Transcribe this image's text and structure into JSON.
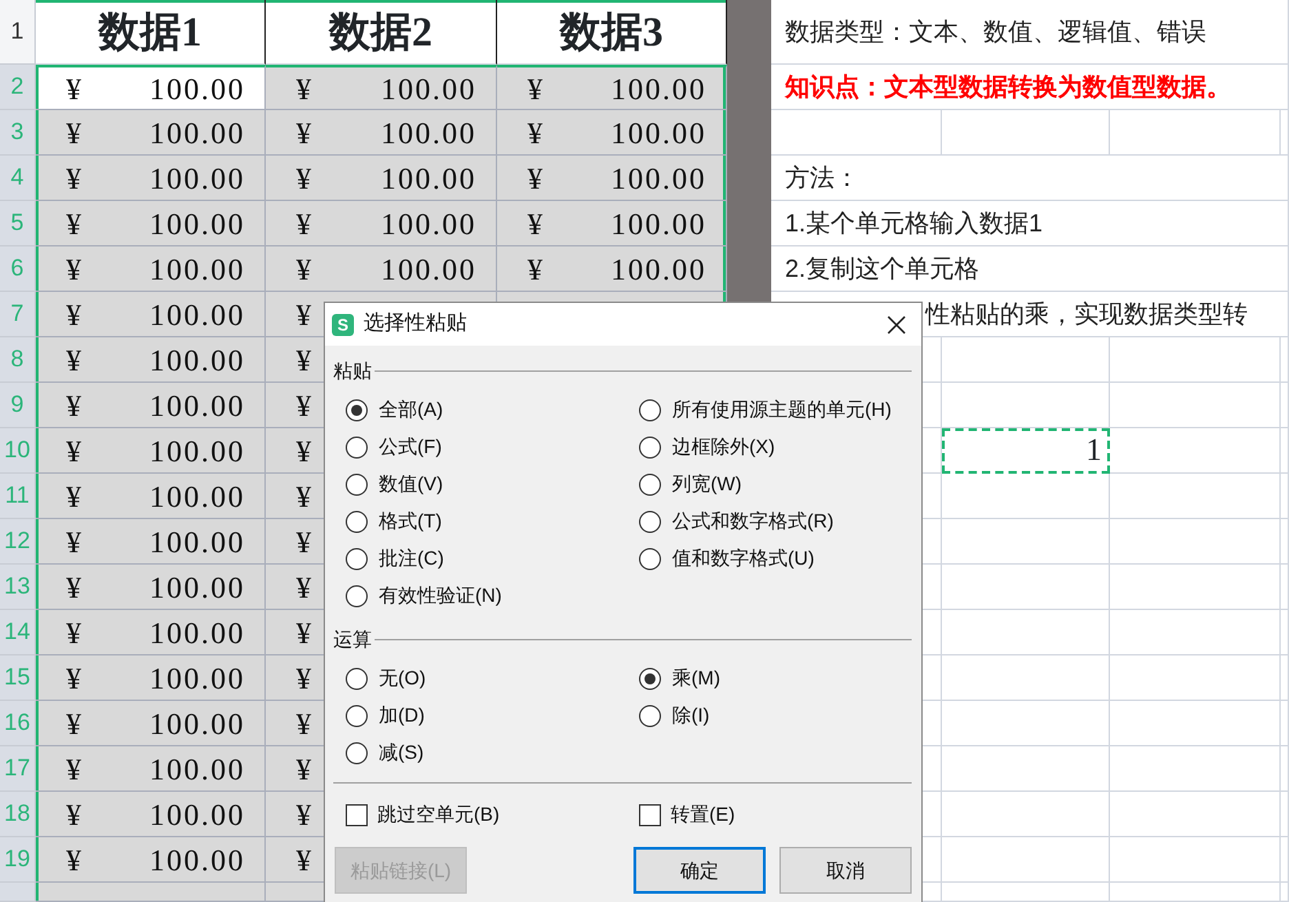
{
  "sheet": {
    "rows": [
      {
        "number": "1",
        "selected": false,
        "kind": "header",
        "cells": [
          {
            "text": "数据1"
          },
          {
            "text": "数据2"
          },
          {
            "text": "数据3"
          }
        ],
        "note": {
          "text": "数据类型：文本、数值、逻辑值、错误",
          "kind": "plain"
        }
      },
      {
        "number": "2",
        "selected": true,
        "kind": "data",
        "cells": [
          {
            "currency": "¥",
            "amount": "100.00",
            "active": true
          },
          {
            "currency": "¥",
            "amount": "100.00",
            "active": false
          },
          {
            "currency": "¥",
            "amount": "100.00",
            "active": false
          }
        ],
        "note": {
          "text": "知识点：文本型数据转换为数值型数据。",
          "kind": "emphasis"
        }
      },
      {
        "number": "3",
        "selected": true,
        "kind": "data",
        "cells": [
          {
            "currency": "¥",
            "amount": "100.00",
            "active": false
          },
          {
            "currency": "¥",
            "amount": "100.00",
            "active": false
          },
          {
            "currency": "¥",
            "amount": "100.00",
            "active": false
          }
        ]
      },
      {
        "number": "4",
        "selected": true,
        "kind": "data",
        "cells": [
          {
            "currency": "¥",
            "amount": "100.00",
            "active": false
          },
          {
            "currency": "¥",
            "amount": "100.00",
            "active": false
          },
          {
            "currency": "¥",
            "amount": "100.00",
            "active": false
          }
        ],
        "note": {
          "text": "方法：",
          "kind": "plain"
        }
      },
      {
        "number": "5",
        "selected": true,
        "kind": "data",
        "cells": [
          {
            "currency": "¥",
            "amount": "100.00",
            "active": false
          },
          {
            "currency": "¥",
            "amount": "100.00",
            "active": false
          },
          {
            "currency": "¥",
            "amount": "100.00",
            "active": false
          }
        ],
        "note": {
          "text": "1.某个单元格输入数据1",
          "kind": "plain"
        }
      },
      {
        "number": "6",
        "selected": true,
        "kind": "data",
        "cells": [
          {
            "currency": "¥",
            "amount": "100.00",
            "active": false
          },
          {
            "currency": "¥",
            "amount": "100.00",
            "active": false
          },
          {
            "currency": "¥",
            "amount": "100.00",
            "active": false
          }
        ],
        "note": {
          "text": "2.复制这个单元格",
          "kind": "plain"
        }
      },
      {
        "number": "7",
        "selected": true,
        "kind": "data",
        "cells": [
          {
            "currency": "¥",
            "amount": "100.00",
            "active": false
          },
          {
            "currency": "¥",
            "active": false
          }
        ],
        "note": {
          "text": "性粘贴的乘，实现数据类型转",
          "kind": "covered"
        }
      },
      {
        "number": "8",
        "selected": true,
        "kind": "data",
        "cells": [
          {
            "currency": "¥",
            "amount": "100.00",
            "active": false
          },
          {
            "currency": "¥",
            "active": false
          }
        ]
      },
      {
        "number": "9",
        "selected": true,
        "kind": "data",
        "cells": [
          {
            "currency": "¥",
            "amount": "100.00",
            "active": false
          },
          {
            "currency": "¥",
            "active": false
          }
        ]
      },
      {
        "number": "10",
        "selected": true,
        "kind": "data",
        "cells": [
          {
            "currency": "¥",
            "amount": "100.00",
            "active": false
          },
          {
            "currency": "¥",
            "active": false
          }
        ],
        "copied_cell": {
          "text": "1"
        }
      },
      {
        "number": "11",
        "selected": true,
        "kind": "data",
        "cells": [
          {
            "currency": "¥",
            "amount": "100.00",
            "active": false
          },
          {
            "currency": "¥",
            "active": false
          }
        ]
      },
      {
        "number": "12",
        "selected": true,
        "kind": "data",
        "cells": [
          {
            "currency": "¥",
            "amount": "100.00",
            "active": false
          },
          {
            "currency": "¥",
            "active": false
          }
        ]
      },
      {
        "number": "13",
        "selected": true,
        "kind": "data",
        "cells": [
          {
            "currency": "¥",
            "amount": "100.00",
            "active": false
          },
          {
            "currency": "¥",
            "active": false
          }
        ]
      },
      {
        "number": "14",
        "selected": true,
        "kind": "data",
        "cells": [
          {
            "currency": "¥",
            "amount": "100.00",
            "active": false
          },
          {
            "currency": "¥",
            "active": false
          }
        ]
      },
      {
        "number": "15",
        "selected": true,
        "kind": "data",
        "cells": [
          {
            "currency": "¥",
            "amount": "100.00",
            "active": false
          },
          {
            "currency": "¥",
            "active": false
          }
        ]
      },
      {
        "number": "16",
        "selected": true,
        "kind": "data",
        "cells": [
          {
            "currency": "¥",
            "amount": "100.00",
            "active": false
          },
          {
            "currency": "¥",
            "active": false
          }
        ]
      },
      {
        "number": "17",
        "selected": true,
        "kind": "data",
        "cells": [
          {
            "currency": "¥",
            "amount": "100.00",
            "active": false
          },
          {
            "currency": "¥",
            "active": false
          }
        ]
      },
      {
        "number": "18",
        "selected": true,
        "kind": "data",
        "cells": [
          {
            "currency": "¥",
            "amount": "100.00",
            "active": false
          },
          {
            "currency": "¥",
            "active": false
          }
        ]
      },
      {
        "number": "19",
        "selected": true,
        "kind": "data",
        "cells": [
          {
            "currency": "¥",
            "amount": "100.00",
            "active": false
          },
          {
            "currency": "¥",
            "active": false
          }
        ]
      }
    ]
  },
  "dialog": {
    "logo": "S",
    "title": "选择性粘贴",
    "groups": [
      {
        "label": "粘贴",
        "options": [
          {
            "label": "全部(A)",
            "selected": true
          },
          {
            "label": "公式(F)",
            "selected": false
          },
          {
            "label": "数值(V)",
            "selected": false
          },
          {
            "label": "格式(T)",
            "selected": false
          },
          {
            "label": "批注(C)",
            "selected": false
          },
          {
            "label": "有效性验证(N)",
            "selected": false
          },
          {
            "label": "所有使用源主题的单元(H)",
            "selected": false
          },
          {
            "label": "边框除外(X)",
            "selected": false
          },
          {
            "label": "列宽(W)",
            "selected": false
          },
          {
            "label": "公式和数字格式(R)",
            "selected": false
          },
          {
            "label": "值和数字格式(U)",
            "selected": false
          }
        ]
      },
      {
        "label": "运算",
        "options": [
          {
            "label": "无(O)",
            "selected": false
          },
          {
            "label": "加(D)",
            "selected": false
          },
          {
            "label": "减(S)",
            "selected": false
          },
          {
            "label": "乘(M)",
            "selected": true
          },
          {
            "label": "除(I)",
            "selected": false
          }
        ]
      }
    ],
    "checkboxes": [
      {
        "label": "跳过空单元(B)",
        "checked": false
      },
      {
        "label": "转置(E)",
        "checked": false
      }
    ],
    "buttons": [
      {
        "label": "粘贴链接(L)",
        "disabled": true,
        "default": false
      },
      {
        "label": "确定",
        "disabled": false,
        "default": true
      },
      {
        "label": "取消",
        "disabled": false,
        "default": false
      }
    ]
  }
}
